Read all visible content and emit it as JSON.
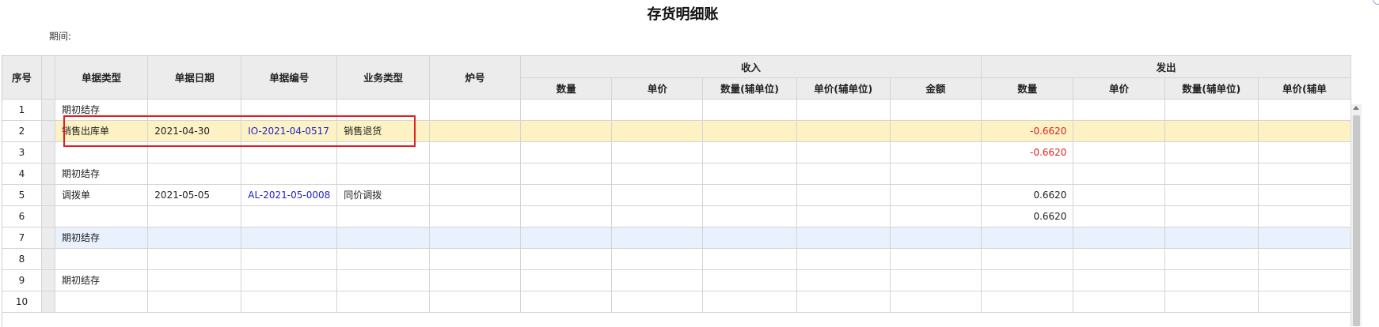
{
  "title": "存货明细账",
  "period_label": "期间:",
  "headers": {
    "seq": "序号",
    "doc_type": "单据类型",
    "doc_date": "单据日期",
    "doc_no": "单据编号",
    "biz_type": "业务类型",
    "furnace": "炉号",
    "receive_group": "收入",
    "issue_group": "发出",
    "receive_cols": [
      "数量",
      "单价",
      "数量(辅单位)",
      "单价(辅单位)",
      "金额"
    ],
    "issue_cols": [
      "数量",
      "单价",
      "数量(辅单位)",
      "单价(辅单"
    ]
  },
  "rows": [
    {
      "seq": "1",
      "doc_type": "期初结存",
      "doc_date": "",
      "doc_no": "",
      "biz_type": "",
      "issue_qty": ""
    },
    {
      "seq": "2",
      "doc_type": "销售出库单",
      "doc_date": "2021-04-30",
      "doc_no": "IO-2021-04-0517",
      "biz_type": "销售退货",
      "issue_qty": "-0.6620"
    },
    {
      "seq": "3",
      "doc_type": "",
      "doc_date": "",
      "doc_no": "",
      "biz_type": "",
      "issue_qty": "-0.6620"
    },
    {
      "seq": "4",
      "doc_type": "期初结存",
      "doc_date": "",
      "doc_no": "",
      "biz_type": "",
      "issue_qty": ""
    },
    {
      "seq": "5",
      "doc_type": "调拨单",
      "doc_date": "2021-05-05",
      "doc_no": "AL-2021-05-0008",
      "biz_type": "同价调拨",
      "issue_qty": "0.6620"
    },
    {
      "seq": "6",
      "doc_type": "",
      "doc_date": "",
      "doc_no": "",
      "biz_type": "",
      "issue_qty": "0.6620"
    },
    {
      "seq": "7",
      "doc_type": "期初结存",
      "doc_date": "",
      "doc_no": "",
      "biz_type": "",
      "issue_qty": ""
    },
    {
      "seq": "8",
      "doc_type": "",
      "doc_date": "",
      "doc_no": "",
      "biz_type": "",
      "issue_qty": ""
    },
    {
      "seq": "9",
      "doc_type": "期初结存",
      "doc_date": "",
      "doc_no": "",
      "biz_type": "",
      "issue_qty": ""
    },
    {
      "seq": "10",
      "doc_type": "",
      "doc_date": "",
      "doc_no": "",
      "biz_type": "",
      "issue_qty": ""
    }
  ],
  "colors": {
    "negative": "#e02020",
    "link": "#2222cc",
    "selected_row": "#fdf2c4",
    "hover_row": "#e8f1fc",
    "highlight_box": "#e02020"
  }
}
